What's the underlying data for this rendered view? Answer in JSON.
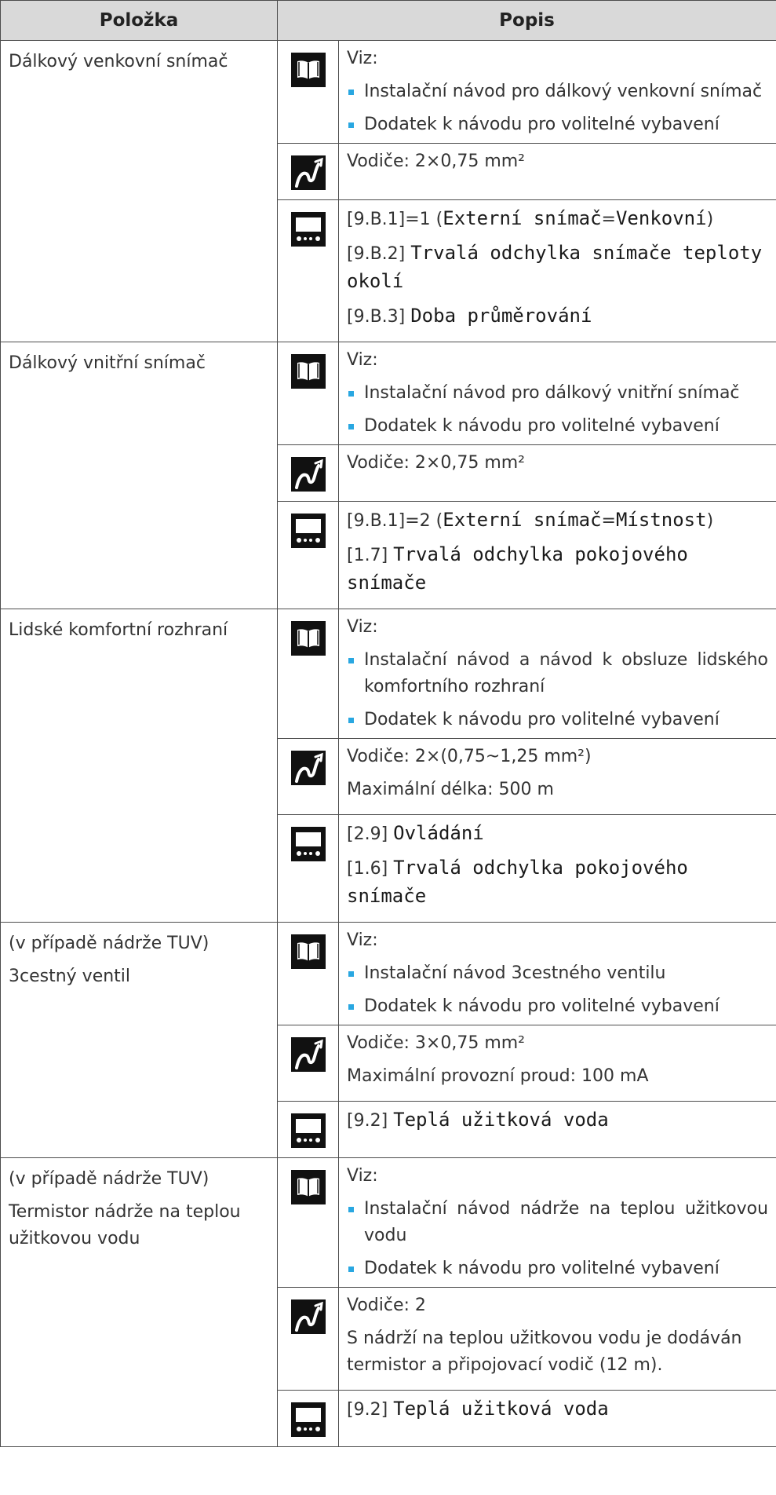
{
  "header": {
    "col1": "Položka",
    "col2": "Popis"
  },
  "colors": {
    "header_bg": "#d9d9d9",
    "bullet": "#29a7e1",
    "border": "#4d4d4d"
  },
  "icons": {
    "manual": "book-icon",
    "wiring": "wire-icon",
    "ui": "user-interface-icon"
  },
  "rows": [
    {
      "item": [
        "Dálkový venkovní snímač"
      ],
      "manual": {
        "intro": "Viz:",
        "bullets": [
          "Instalační návod pro dálkový venkovní snímač",
          "Dodatek k návodu pro volitelné vybavení"
        ]
      },
      "wiring": [
        "Vodiče: 2×0,75 mm²"
      ],
      "ui": [
        {
          "code": "[9.B.1]=1 (",
          "mono": "Externí snímač",
          "eq": "=",
          "mono2": "Venkovní",
          "end": ")"
        },
        {
          "code": "[9.B.2] ",
          "mono": "Trvalá odchylka snímače teploty okolí"
        },
        {
          "code": "[9.B.3] ",
          "mono": "Doba průměrování"
        }
      ]
    },
    {
      "item": [
        "Dálkový vnitřní snímač"
      ],
      "manual": {
        "intro": "Viz:",
        "bullets": [
          "Instalační návod pro dálkový vnitřní snímač",
          "Dodatek k návodu pro volitelné vybavení"
        ]
      },
      "wiring": [
        "Vodiče: 2×0,75 mm²"
      ],
      "ui": [
        {
          "code": "[9.B.1]=2 (",
          "mono": "Externí snímač",
          "eq": "=",
          "mono2": "Místnost",
          "end": ")"
        },
        {
          "code": "[1.7] ",
          "mono": "Trvalá odchylka pokojového snímače"
        }
      ]
    },
    {
      "item": [
        "Lidské komfortní rozhraní"
      ],
      "manual": {
        "intro": "Viz:",
        "bullets": [
          "Instalační návod a návod k obsluze lidského komfortního rozhraní",
          "Dodatek k návodu pro volitelné vybavení"
        ]
      },
      "wiring": [
        "Vodiče: 2×(0,75~1,25 mm²)",
        "Maximální délka: 500 m"
      ],
      "ui": [
        {
          "code": "[2.9] ",
          "mono": "Ovládání"
        },
        {
          "code": "[1.6] ",
          "mono": "Trvalá odchylka pokojového snímače"
        }
      ]
    },
    {
      "item": [
        "(v případě nádrže TUV)",
        "3cestný ventil"
      ],
      "manual": {
        "intro": "Viz:",
        "bullets": [
          "Instalační návod 3cestného ventilu",
          "Dodatek k návodu pro volitelné vybavení"
        ]
      },
      "wiring": [
        "Vodiče: 3×0,75 mm²",
        "Maximální provozní proud: 100 mA"
      ],
      "ui": [
        {
          "code": "[9.2] ",
          "mono": "Teplá užitková voda"
        }
      ]
    },
    {
      "item": [
        "(v případě nádrže TUV)",
        "Termistor nádrže na teplou užitkovou vodu"
      ],
      "manual": {
        "intro": "Viz:",
        "bullets": [
          "Instalační návod nádrže na teplou užitkovou vodu",
          "Dodatek k návodu pro volitelné vybavení"
        ]
      },
      "wiring": [
        "Vodiče: 2",
        "S nádrží na teplou užitkovou vodu je dodáván termistor a připojovací vodič (12 m)."
      ],
      "ui": [
        {
          "code": "[9.2] ",
          "mono": "Teplá užitková voda"
        }
      ]
    }
  ]
}
